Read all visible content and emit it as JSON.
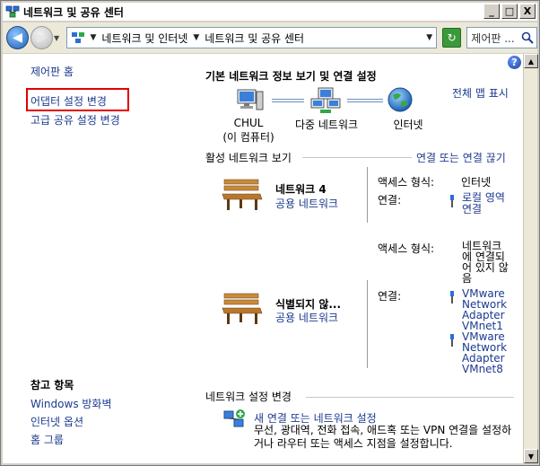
{
  "window": {
    "title": "네트워크 및 공유 센터",
    "buttons": [
      "_",
      "□",
      "X"
    ]
  },
  "address": {
    "crumbs": [
      "네트워크 및 인터넷",
      "네트워크 및 공유 센터"
    ],
    "search_placeholder": "제어판 ..."
  },
  "sidebar": {
    "home": "제어판 홈",
    "adapter_settings": "어댑터 설정 변경",
    "advanced_sharing": "고급 공유 설정 변경"
  },
  "see_also": {
    "title": "참고 항목",
    "items": [
      "Windows 방화벽",
      "인터넷 옵션",
      "홈 그룹"
    ]
  },
  "main": {
    "heading": "기본 네트워크 정보 보기 및 연결 설정",
    "full_map": "전체 맵 표시",
    "map_nodes": {
      "computer_line1": "CHUL",
      "computer_line2": "(이 컴퓨터)",
      "network": "다중 네트워크",
      "internet": "인터넷"
    }
  },
  "active": {
    "title": "활성 네트워크 보기",
    "connect_link": "연결 또는 연결 끊기",
    "networks": [
      {
        "name": "네트워크 4",
        "type": "공용 네트워크",
        "access_label": "액세스 형식:",
        "access_value": "인터넷",
        "conn_label": "연결:",
        "conn_lines": [
          "로컬 영역",
          "연결"
        ]
      },
      {
        "name": "식별되지 않...",
        "type": "공용 네트워크",
        "access_label": "액세스 형식:",
        "access_lines": [
          "네트워크",
          "에 연결되",
          "어 있지 않",
          "음"
        ],
        "conn_label": "연결:",
        "adapter1": [
          "VMware",
          "Network",
          "Adapter",
          "VMnet1"
        ],
        "adapter2": [
          "VMware",
          "Network",
          "Adapter",
          "VMnet8"
        ]
      }
    ]
  },
  "change": {
    "title": "네트워크 설정 변경",
    "new_conn": "새 연결 또는 네트워크 설정",
    "new_conn_desc": "무선, 광대역, 전화 접속, 애드혹 또는 VPN 연결을 설정하거나 라우터 또는 액세스 지점을 설정합니다."
  },
  "colors": {
    "link": "#1c3a8f",
    "highlight_border": "#e20000"
  }
}
